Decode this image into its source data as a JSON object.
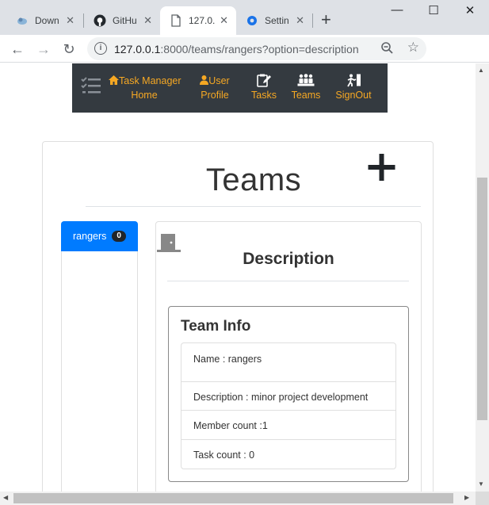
{
  "browser": {
    "tabs": [
      {
        "title": "Down",
        "icon": "cloud-bird-icon"
      },
      {
        "title": "GitHu",
        "icon": "github-icon"
      },
      {
        "title": "127.0.",
        "icon": "page-icon",
        "active": true
      },
      {
        "title": "Settin",
        "icon": "gear-icon"
      }
    ],
    "url_host": "127.0.0.1",
    "url_rest": ":8000/teams/rangers?option=description"
  },
  "nav": {
    "home_line1": "Task Manager",
    "home_line2": "Home",
    "profile_line1": "User",
    "profile_line2": "Profile",
    "tasks": "Tasks",
    "teams": "Teams",
    "signout": "SignOut"
  },
  "page": {
    "title": "Teams",
    "sidebar": {
      "items": [
        {
          "name": "rangers",
          "count": "0",
          "active": true
        }
      ]
    },
    "panel": {
      "heading": "Description",
      "info_title": "Team Info",
      "rows": [
        "Name : rangers",
        "Description : minor project development",
        "Member count :1",
        "Task count : 0"
      ]
    }
  },
  "colors": {
    "navbar_bg": "#343a40",
    "nav_accent": "#f6a823",
    "active_item": "#007bff"
  }
}
